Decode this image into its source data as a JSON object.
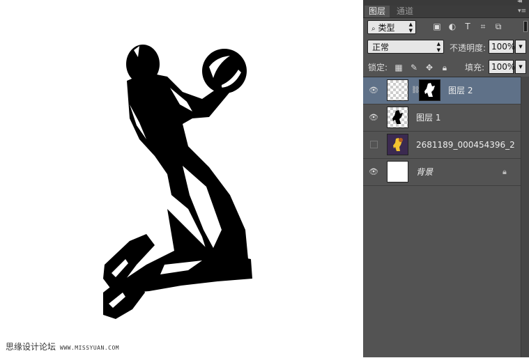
{
  "panel": {
    "tabs": [
      {
        "label": "图层",
        "active": true
      },
      {
        "label": "通道",
        "active": false
      }
    ],
    "filter": {
      "label": "类型",
      "icon": "search-icon"
    },
    "filter_icons": [
      "image-filter-icon",
      "adjustment-filter-icon",
      "type-filter-icon",
      "shape-filter-icon",
      "smart-object-filter-icon"
    ],
    "blend_mode": "正常",
    "opacity": {
      "label": "不透明度:",
      "value": "100%"
    },
    "lock": {
      "label": "锁定:",
      "icons": [
        "lock-transparent-icon",
        "lock-image-icon",
        "lock-position-icon",
        "lock-all-icon"
      ]
    },
    "fill": {
      "label": "填充:",
      "value": "100%"
    },
    "layers": [
      {
        "name": "图层 2",
        "visible": true,
        "selected": true,
        "has_mask": true
      },
      {
        "name": "图层 1",
        "visible": true,
        "selected": false
      },
      {
        "name": "2681189_000454396_2",
        "visible": false,
        "selected": false
      },
      {
        "name": "背景",
        "visible": true,
        "selected": false,
        "locked": true
      }
    ],
    "colors": {
      "panel_bg": "#535353",
      "selected_row": "#5f7188"
    }
  },
  "watermark": {
    "text": "思缘设计论坛",
    "url": "WWW.MISSYUAN.COM"
  }
}
